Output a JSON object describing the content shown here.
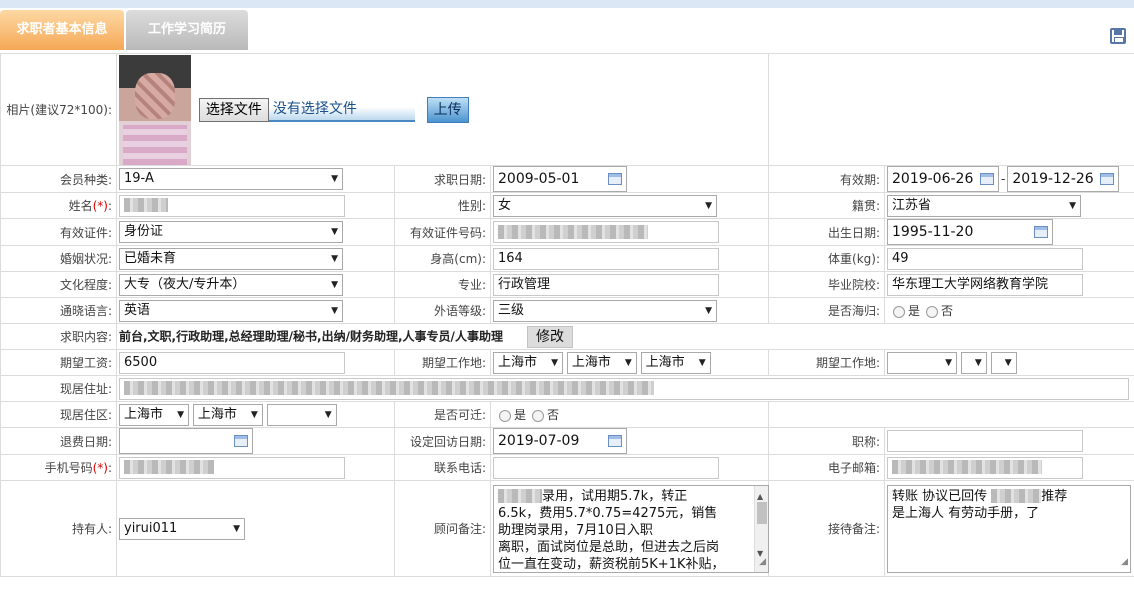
{
  "tabs": [
    {
      "label": "求职者基本信息",
      "active": true
    },
    {
      "label": "工作学习简历",
      "active": false
    }
  ],
  "colors": {
    "tab_active": "#f5a855",
    "tab_inactive": "#b9b9b9",
    "accent_blue": "#4c93cf"
  },
  "photo": {
    "label": "相片(建议72*100):",
    "choose_file_button": "选择文件",
    "file_status": "没有选择文件",
    "upload_button": "上传"
  },
  "row1": {
    "member_type": {
      "label": "会员种类:",
      "value": "19-A"
    },
    "apply_date": {
      "label": "求职日期:",
      "value": "2009-05-01"
    },
    "valid_period": {
      "label": "有效期:",
      "from": "2019-06-26",
      "sep": "-",
      "to": "2019-12-26"
    }
  },
  "row2": {
    "name": {
      "label": "姓名",
      "req": "(*)",
      "colon": ":"
    },
    "gender": {
      "label": "性别:",
      "value": "女"
    },
    "native_place": {
      "label": "籍贯:",
      "value": "江苏省"
    }
  },
  "row3": {
    "id_type": {
      "label": "有效证件:",
      "value": "身份证"
    },
    "id_number": {
      "label": "有效证件号码:"
    },
    "birth_date": {
      "label": "出生日期:",
      "value": "1995-11-20"
    }
  },
  "row4": {
    "marital": {
      "label": "婚姻状况:",
      "value": "已婚未育"
    },
    "height": {
      "label": "身高(cm):",
      "value": "164"
    },
    "weight": {
      "label": "体重(kg):",
      "value": "49"
    }
  },
  "row5": {
    "education": {
      "label": "文化程度:",
      "value": "大专（夜大/专升本）"
    },
    "major": {
      "label": "专业:",
      "value": "行政管理"
    },
    "school": {
      "label": "毕业院校:",
      "value": "华东理工大学网络教育学院"
    }
  },
  "row6": {
    "language": {
      "label": "通晓语言:",
      "value": "英语"
    },
    "foreign_level": {
      "label": "外语等级:",
      "value": "三级"
    },
    "overseas": {
      "label": "是否海归:",
      "yes": "是",
      "no": "否"
    }
  },
  "row7": {
    "job_content": {
      "label": "求职内容:",
      "value": "前台,文职,行政助理,总经理助理/秘书,出纳/财务助理,人事专员/人事助理",
      "edit_button": "修改"
    }
  },
  "row8": {
    "salary": {
      "label": "期望工资:",
      "value": "6500"
    },
    "work_place": {
      "label": "期望工作地:",
      "values": [
        "上海市",
        "上海市",
        "上海市"
      ]
    },
    "work_place2": {
      "label": "期望工作地:"
    }
  },
  "row9": {
    "address": {
      "label": "现居住址:"
    }
  },
  "row10": {
    "current_area": {
      "label": "现居住区:",
      "values": [
        "上海市",
        "上海市"
      ]
    },
    "relocate": {
      "label": "是否可迁:",
      "yes": "是",
      "no": "否"
    }
  },
  "row11": {
    "refund_date": {
      "label": "退费日期:"
    },
    "revisit_date": {
      "label": "设定回访日期:",
      "value": "2019-07-09"
    },
    "title": {
      "label": "职称:"
    }
  },
  "row12": {
    "mobile": {
      "label": "手机号码",
      "req": "(*)",
      "colon": ":"
    },
    "contact_phone": {
      "label": "联系电话:"
    },
    "email": {
      "label": "电子邮箱:"
    }
  },
  "row13": {
    "holder": {
      "label": "持有人:",
      "value": "yirui011"
    },
    "advisor_note": {
      "label": "顾问备注:",
      "lines": [
        "录用，试用期5.7k，转正",
        "6.5k，费用5.7*0.75=4275元，销售",
        "助理岗录用，7月10日入职",
        "离职，面试岗位是总助，但进去之后岗",
        "位一直在变动，薪资税前5K+1K补贴，"
      ]
    },
    "reception_note": {
      "label": "接待备注:",
      "line1_a": "转账  协议已回传",
      "line1_b": "推荐",
      "line2": "是上海人  有劳动手册，了"
    }
  }
}
